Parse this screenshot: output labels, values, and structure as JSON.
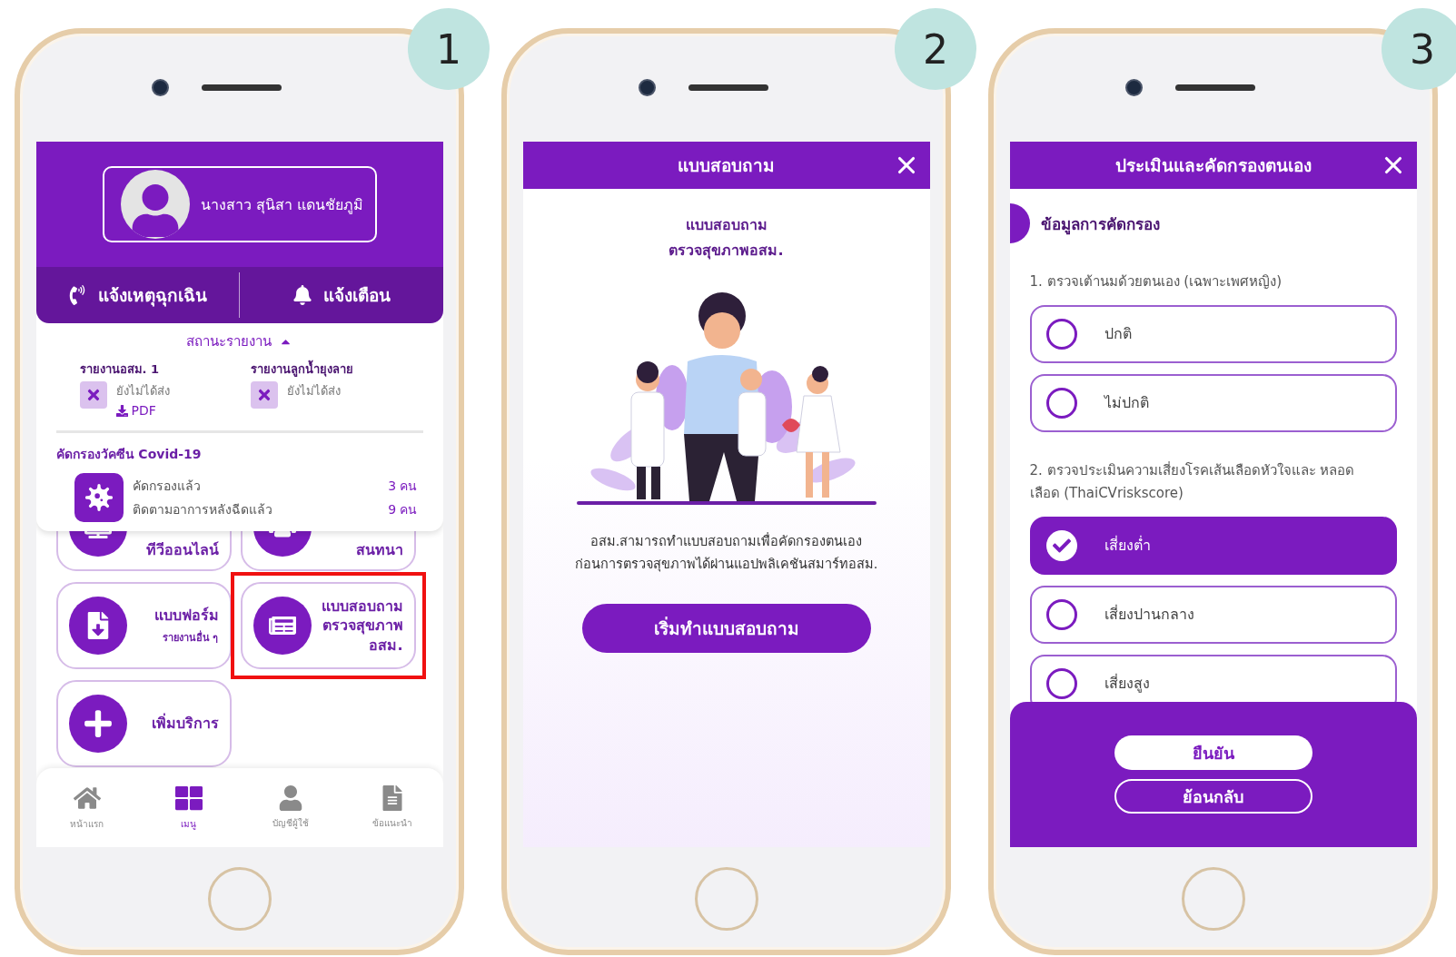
{
  "step_badges": [
    "1",
    "2",
    "3"
  ],
  "home": {
    "profile": {
      "name": "นางสาว สุนิสา แดนชัยภูมิ"
    },
    "actions": [
      {
        "label": "แจ้งเหตุฉุกเฉิน",
        "kind": "emergency"
      },
      {
        "label": "แจ้งเตือน",
        "kind": "alert"
      }
    ],
    "status_toggle": {
      "label": "สถานะรายงาน",
      "expanded": true
    },
    "reports": [
      {
        "title": "รายงานอสม. 1",
        "status": "ยังไม่ได้ส่ง",
        "download": "PDF"
      },
      {
        "title": "รายงานลูกน้ำยุงลาย",
        "status": "ยังไม่ได้ส่ง"
      }
    ],
    "covid": {
      "title": "คัดกรองวัคซีน Covid-19",
      "rows": [
        {
          "label": "คัดกรองแล้ว",
          "count": "3 คน"
        },
        {
          "label": "ติดตามอาการหลังฉีดแล้ว",
          "count": "9 คน"
        }
      ]
    },
    "services_partial": [
      {
        "label": "ทีวีออนไลน์",
        "kind": "tv"
      },
      {
        "label": "สนทนา",
        "kind": "chat"
      }
    ],
    "services": [
      {
        "label": "แบบฟอร์ม",
        "sublabel": "รายงานอื่น ๆ",
        "kind": "form",
        "highlighted": false
      },
      {
        "label": "แบบสอบถาม\nตรวจสุขภาพ\nอสม.",
        "kind": "survey",
        "highlighted": true
      },
      {
        "label": "เพิ่มบริการ",
        "kind": "add",
        "highlighted": false
      }
    ],
    "nav": [
      {
        "label": "หน้าแรก",
        "kind": "home",
        "selected": false
      },
      {
        "label": "เมนู",
        "kind": "menu",
        "selected": true
      },
      {
        "label": "บัญชีผู้ใช้",
        "kind": "account",
        "selected": false
      },
      {
        "label": "ข้อแนะนำ",
        "kind": "guide",
        "selected": false
      }
    ]
  },
  "intro": {
    "title": "แบบสอบถาม",
    "heading": "แบบสอบถาม\nตรวจสุขภาพอสม.",
    "description": "อสม.สามารถทำแบบสอบถามเพื่อคัดกรองตนเอง\nก่อนการตรวจสุขภาพได้ผ่านแอปพลิเคชันสมาร์ทอสม.",
    "button": "เริ่มทำแบบสอบถาม"
  },
  "screening": {
    "title": "ประเมินและคัดกรองตนเอง",
    "section": "ข้อมูลการคัดกรอง",
    "questions": [
      {
        "text": "1. ตรวจเต้านมด้วยตนเอง (เฉพาะเพศหญิง)",
        "options": [
          {
            "label": "ปกติ",
            "selected": false
          },
          {
            "label": "ไม่ปกติ",
            "selected": false
          }
        ]
      },
      {
        "text": "2. ตรวจประเมินความเสี่ยงโรคเส้นเลือดหัวใจและ หลอด\nเลือด (ThaiCVriskscore)",
        "options": [
          {
            "label": "เสี่ยงต่ำ",
            "selected": true
          },
          {
            "label": "เสี่ยงปานกลาง",
            "selected": false
          },
          {
            "label": "เสี่ยงสูง",
            "selected": false
          }
        ]
      }
    ],
    "actions": [
      {
        "label": "ยืนยัน",
        "kind": "primary"
      },
      {
        "label": "ย้อนกลับ",
        "kind": "secondary"
      }
    ]
  }
}
